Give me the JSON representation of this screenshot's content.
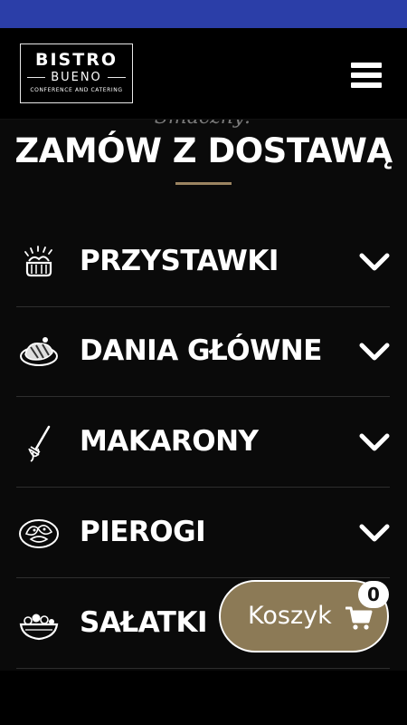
{
  "header": {
    "logo": {
      "name": "BISTRO",
      "subname": "BUENO",
      "tagline": "CONFERENCE AND CATERING"
    },
    "menu_icon": "hamburger-menu-icon"
  },
  "main": {
    "cut_off_text": "Smaczny!",
    "title": "ZAMÓW Z DOSTAWĄ",
    "accent_color": "#9b8461",
    "categories": [
      {
        "label": "PRZYSTAWKI",
        "icon": "appetizer-icon"
      },
      {
        "label": "DANIA GŁÓWNE",
        "icon": "main-dish-icon"
      },
      {
        "label": "MAKARONY",
        "icon": "pasta-fork-icon"
      },
      {
        "label": "PIEROGI",
        "icon": "dumplings-icon"
      },
      {
        "label": "SAŁATKI",
        "icon": "salad-icon"
      }
    ]
  },
  "cart": {
    "label": "Koszyk",
    "count": "0",
    "icon": "cart-icon",
    "color": "#8c7a56"
  },
  "colors": {
    "status_bar": "#2b3ea8",
    "background": "#0a0a0a"
  }
}
